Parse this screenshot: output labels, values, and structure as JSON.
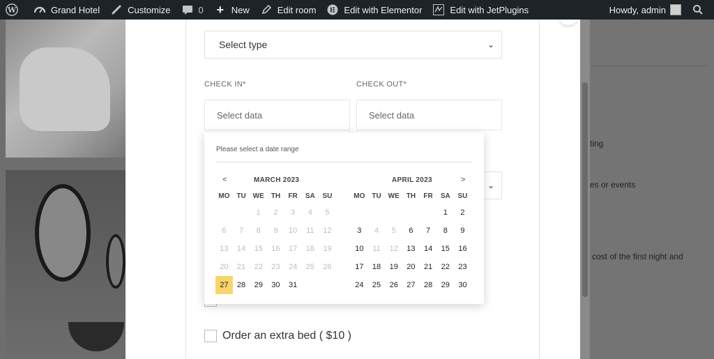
{
  "adminbar": {
    "site_name": "Grand Hotel",
    "customize": "Customize",
    "comments_count": "0",
    "new_label": "New",
    "edit_room": "Edit room",
    "edit_elementor": "Edit with Elementor",
    "edit_jetplugins": "Edit with JetPlugins",
    "howdy": "Howdy, admin"
  },
  "background": {
    "text_ting": "ting",
    "text_events": "es or events",
    "text_cost": "cost of the first night and"
  },
  "form": {
    "type_select": "Select type",
    "check_in_label": "CHECK IN*",
    "check_out_label": "CHECK OUT*",
    "check_in_placeholder": "Select data",
    "check_out_placeholder": "Select data",
    "extra_bed_label": "Order an extra bed ( $10 )"
  },
  "datepicker": {
    "hint": "Please select a date range",
    "prev": "<",
    "next": ">",
    "weekdays": [
      "MO",
      "TU",
      "WE",
      "TH",
      "FR",
      "SA",
      "SU"
    ],
    "months": [
      {
        "title": "MARCH 2023",
        "days": [
          {
            "d": "",
            "s": "empty"
          },
          {
            "d": "",
            "s": "empty"
          },
          {
            "d": "1",
            "s": "dis"
          },
          {
            "d": "2",
            "s": "dis"
          },
          {
            "d": "3",
            "s": "dis"
          },
          {
            "d": "4",
            "s": "dis"
          },
          {
            "d": "5",
            "s": "dis"
          },
          {
            "d": "6",
            "s": "dis"
          },
          {
            "d": "7",
            "s": "dis"
          },
          {
            "d": "8",
            "s": "dis"
          },
          {
            "d": "9",
            "s": "dis"
          },
          {
            "d": "10",
            "s": "dis"
          },
          {
            "d": "11",
            "s": "dis"
          },
          {
            "d": "12",
            "s": "dis"
          },
          {
            "d": "13",
            "s": "dis"
          },
          {
            "d": "14",
            "s": "dis"
          },
          {
            "d": "15",
            "s": "dis"
          },
          {
            "d": "16",
            "s": "dis"
          },
          {
            "d": "17",
            "s": "dis"
          },
          {
            "d": "18",
            "s": "dis"
          },
          {
            "d": "19",
            "s": "dis"
          },
          {
            "d": "20",
            "s": "dis"
          },
          {
            "d": "21",
            "s": "dis"
          },
          {
            "d": "22",
            "s": "dis"
          },
          {
            "d": "23",
            "s": "dis"
          },
          {
            "d": "24",
            "s": "dis"
          },
          {
            "d": "25",
            "s": "dis"
          },
          {
            "d": "26",
            "s": "dis"
          },
          {
            "d": "27",
            "s": "today"
          },
          {
            "d": "28",
            "s": ""
          },
          {
            "d": "29",
            "s": ""
          },
          {
            "d": "30",
            "s": ""
          },
          {
            "d": "31",
            "s": ""
          },
          {
            "d": "",
            "s": "empty"
          },
          {
            "d": "",
            "s": "empty"
          }
        ]
      },
      {
        "title": "APRIL 2023",
        "days": [
          {
            "d": "",
            "s": "empty"
          },
          {
            "d": "",
            "s": "empty"
          },
          {
            "d": "",
            "s": "empty"
          },
          {
            "d": "",
            "s": "empty"
          },
          {
            "d": "",
            "s": "empty"
          },
          {
            "d": "1",
            "s": ""
          },
          {
            "d": "2",
            "s": ""
          },
          {
            "d": "3",
            "s": ""
          },
          {
            "d": "4",
            "s": "dis"
          },
          {
            "d": "5",
            "s": "dis"
          },
          {
            "d": "6",
            "s": ""
          },
          {
            "d": "7",
            "s": ""
          },
          {
            "d": "8",
            "s": ""
          },
          {
            "d": "9",
            "s": ""
          },
          {
            "d": "10",
            "s": ""
          },
          {
            "d": "11",
            "s": "dis"
          },
          {
            "d": "12",
            "s": "dis"
          },
          {
            "d": "13",
            "s": ""
          },
          {
            "d": "14",
            "s": ""
          },
          {
            "d": "15",
            "s": ""
          },
          {
            "d": "16",
            "s": ""
          },
          {
            "d": "17",
            "s": ""
          },
          {
            "d": "18",
            "s": ""
          },
          {
            "d": "19",
            "s": ""
          },
          {
            "d": "20",
            "s": ""
          },
          {
            "d": "21",
            "s": ""
          },
          {
            "d": "22",
            "s": ""
          },
          {
            "d": "23",
            "s": ""
          },
          {
            "d": "24",
            "s": ""
          },
          {
            "d": "25",
            "s": ""
          },
          {
            "d": "26",
            "s": ""
          },
          {
            "d": "27",
            "s": ""
          },
          {
            "d": "28",
            "s": ""
          },
          {
            "d": "29",
            "s": ""
          },
          {
            "d": "30",
            "s": ""
          }
        ]
      }
    ]
  }
}
